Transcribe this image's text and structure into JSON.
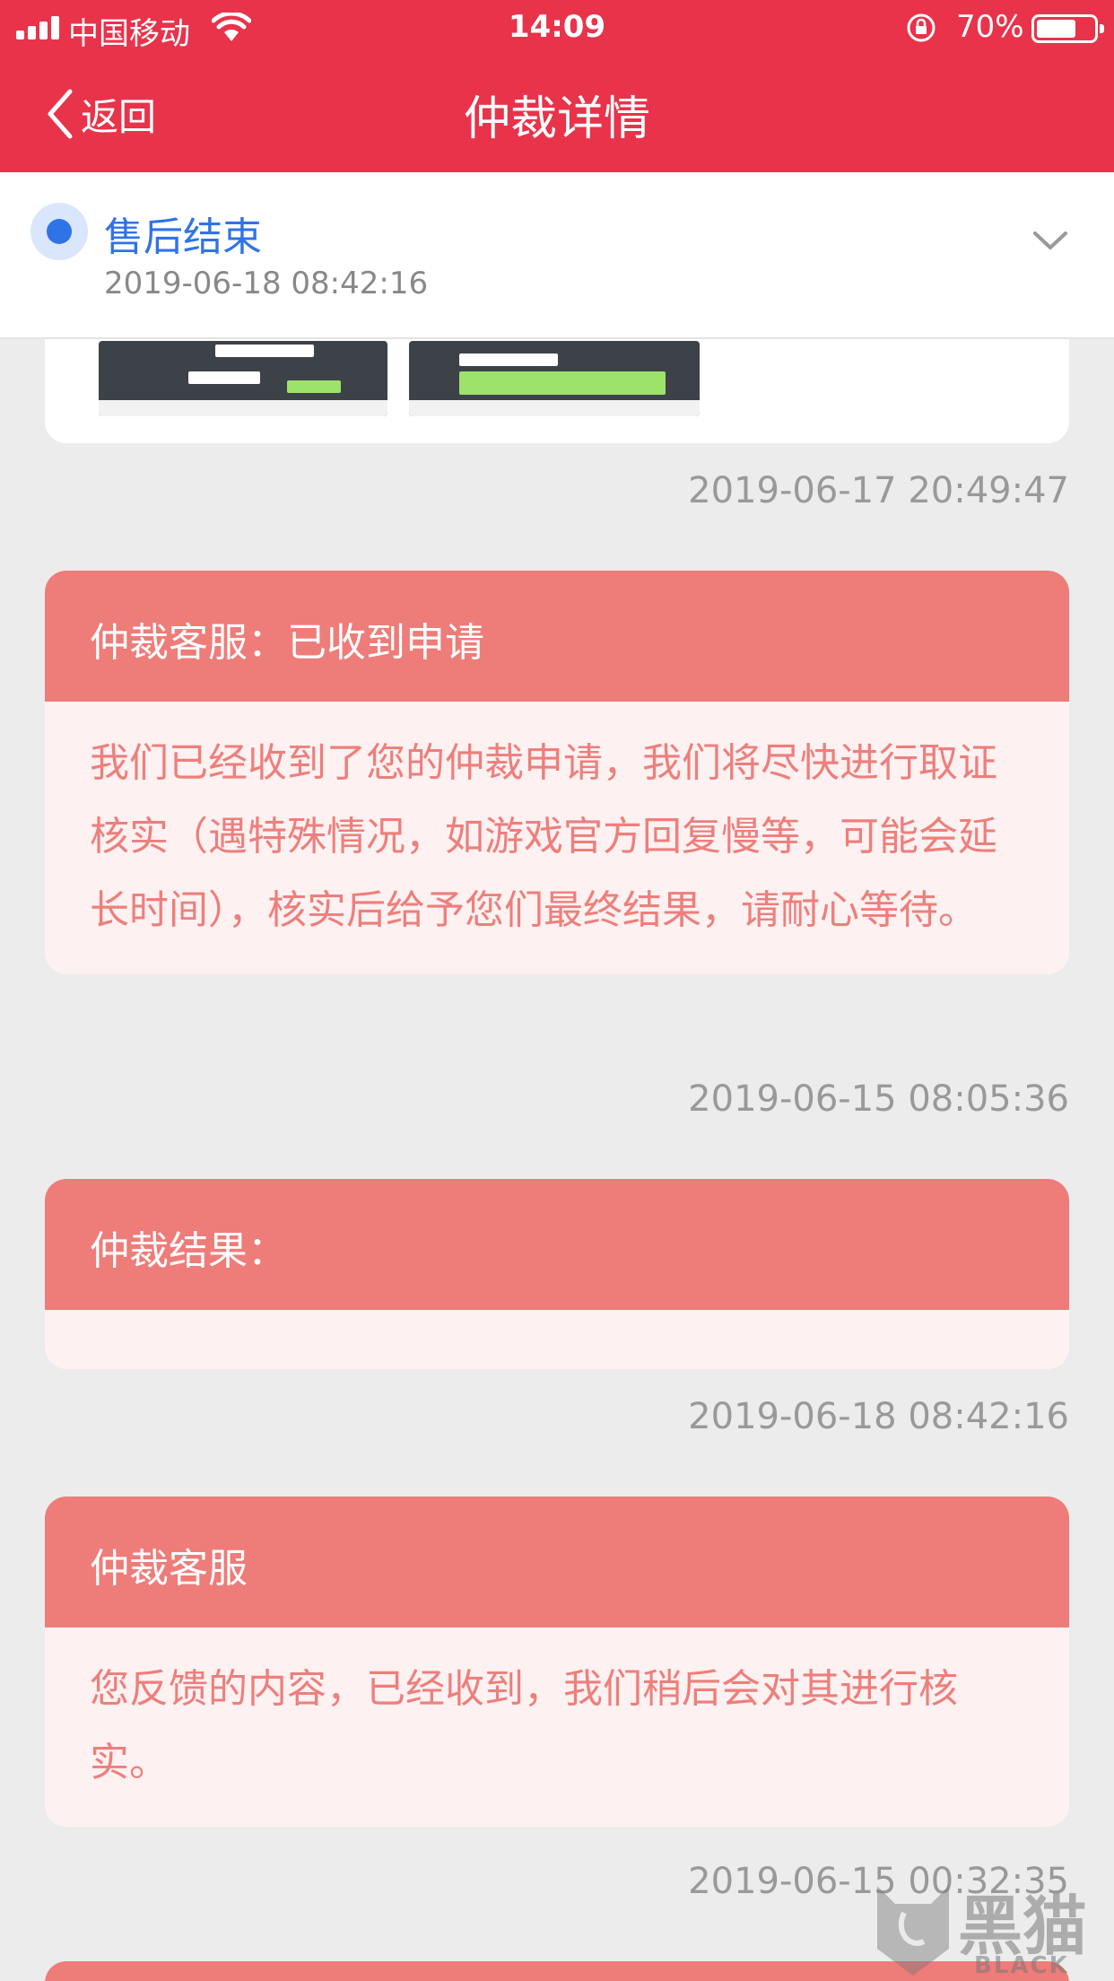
{
  "status_bar": {
    "carrier": "中国移动",
    "time": "14:09",
    "battery": "70%",
    "battery_level": 0.7
  },
  "nav": {
    "back_label": "返回",
    "title": "仲裁详情"
  },
  "status_header": {
    "title": "售后结束",
    "time": "2019-06-18 08:42:16"
  },
  "feed": [
    {
      "timestamp": "2019-06-17 20:49:47"
    },
    {
      "head": "仲裁客服：已收到申请",
      "body": "我们已经收到了您的仲裁申请，我们将尽快进行取证核实（遇特殊情况，如游戏官方回复慢等，可能会延长时间），核实后给予您们最终结果，请耐心等待。",
      "timestamp": "2019-06-15 08:05:36"
    },
    {
      "head": "仲裁结果：",
      "body": "",
      "timestamp": "2019-06-18 08:42:16"
    },
    {
      "head": "仲裁客服",
      "body": "您反馈的内容，已经收到，我们稍后会对其进行核实。",
      "timestamp": "2019-06-15 00:32:35"
    }
  ],
  "watermark": {
    "text": "黑猫",
    "sub": "BLACK CAT"
  },
  "colors": {
    "accent_red": "#e8334a",
    "card_head": "#ee7c79",
    "card_body_bg": "#fdf1f1",
    "card_text": "#ed7f7c",
    "status_blue": "#2f73e8"
  }
}
